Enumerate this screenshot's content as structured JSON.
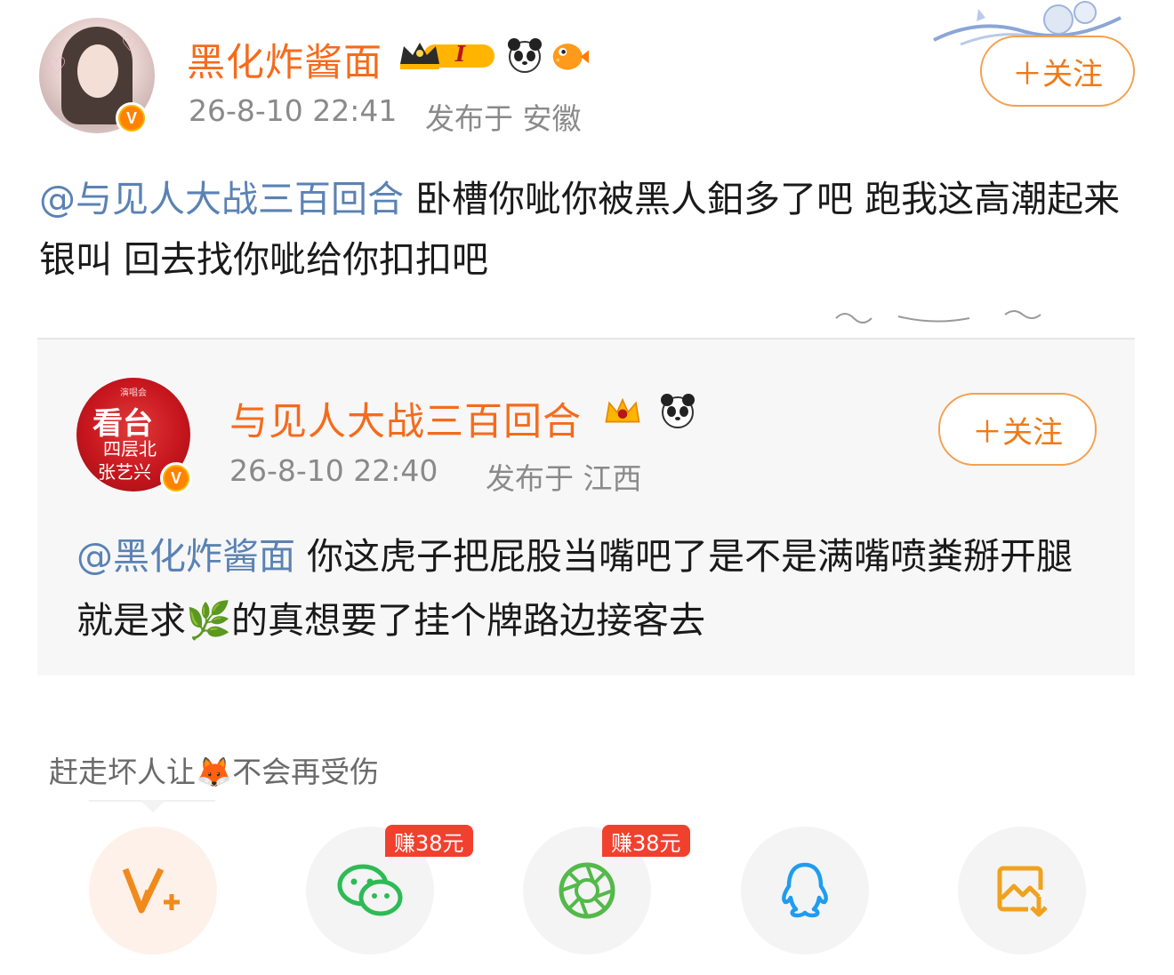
{
  "post": {
    "username": "黑化炸酱面",
    "timestamp": "26-8-10 22:41",
    "location_text": "发布于 安徽",
    "follow_label": "＋关注",
    "level_badge": "I",
    "mention": "@与见人大战三百回合",
    "body": " 卧槽你呲你被黑人鈤多了吧 跑我这高潮起来银叫 回去找你呲给你扣扣吧"
  },
  "quoted": {
    "username": "与见人大战三百回合",
    "timestamp": "26-8-10 22:40",
    "location_text": "发布于 江西",
    "follow_label": "＋关注",
    "avatar_line1": "看台",
    "avatar_line2": "四层北",
    "avatar_line3": "张艺兴",
    "mention": "@黑化炸酱面",
    "body": " 你这虎子把屁股当嘴吧了是不是满嘴喷粪掰开腿就是求🌿的真想要了挂个牌路边接客去"
  },
  "share": {
    "title": "赶走坏人让🦊不会再受伤",
    "buttons": [
      {
        "name": "weibo-vplus",
        "icon": "vplus-icon",
        "tag": ""
      },
      {
        "name": "wechat",
        "icon": "wechat-icon",
        "tag": "赚38元"
      },
      {
        "name": "moments",
        "icon": "moments-icon",
        "tag": "赚38元"
      },
      {
        "name": "qq",
        "icon": "qq-icon",
        "tag": ""
      },
      {
        "name": "save-image",
        "icon": "save-image-icon",
        "tag": ""
      }
    ]
  },
  "colors": {
    "username": "#f56b1c",
    "mention": "#5b82b3",
    "follow": "#ee7a19",
    "earn_tag": "#f2402f"
  }
}
